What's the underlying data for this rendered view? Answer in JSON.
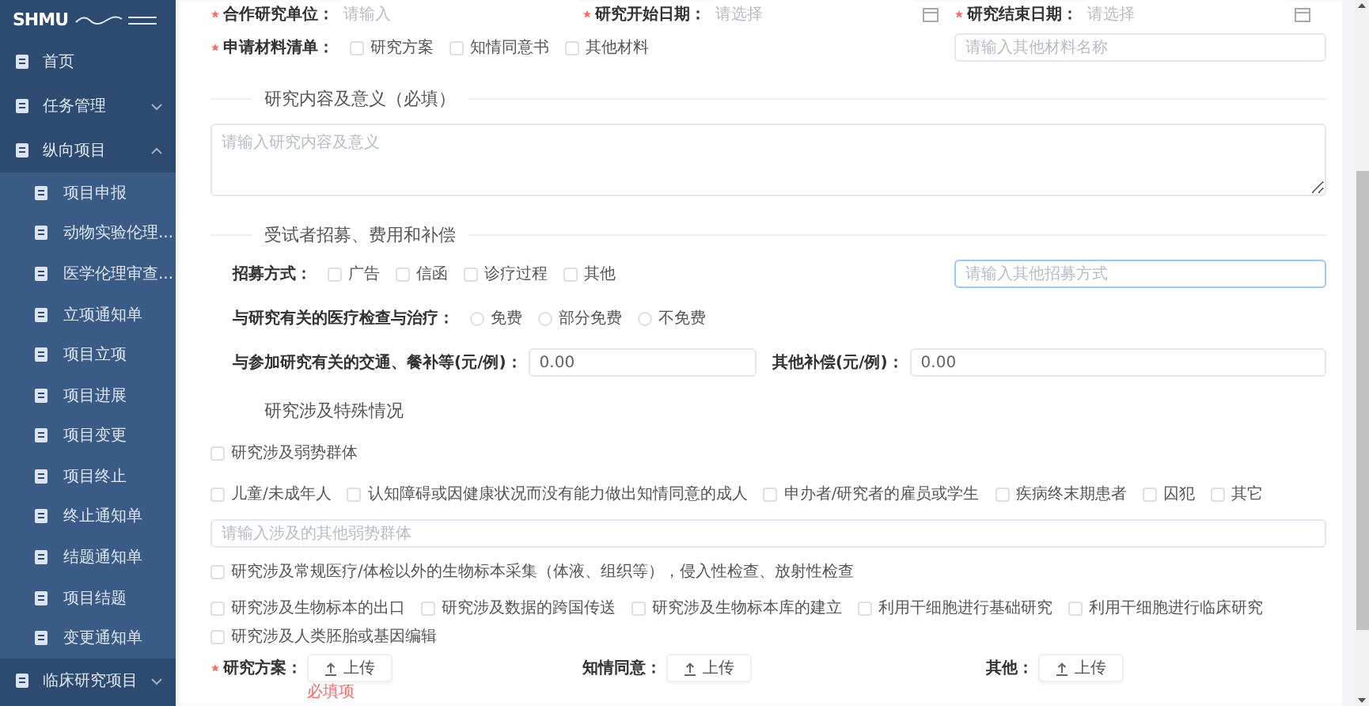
{
  "sidebar": {
    "logo": "SHMU",
    "items": [
      {
        "label": "首页"
      },
      {
        "label": "任务管理",
        "expanded": false
      },
      {
        "label": "纵向项目",
        "expanded": true,
        "children": [
          {
            "label": "项目申报",
            "selected": false
          },
          {
            "label": "动物实验伦理...",
            "selected": false
          },
          {
            "label": "医学伦理审查...",
            "selected": false
          },
          {
            "label": "立项通知单",
            "selected": false
          },
          {
            "label": "项目立项",
            "selected": false
          },
          {
            "label": "项目进展",
            "selected": false
          },
          {
            "label": "项目变更",
            "selected": false
          },
          {
            "label": "项目终止",
            "selected": false
          },
          {
            "label": "终止通知单",
            "selected": false
          },
          {
            "label": "结题通知单",
            "selected": false
          },
          {
            "label": "项目结题",
            "selected": false
          },
          {
            "label": "变更通知单",
            "selected": false
          }
        ]
      },
      {
        "label": "临床研究项目",
        "expanded": false
      }
    ]
  },
  "form": {
    "blocks": [
      {
        "kind": "fields",
        "fields": [
          {
            "kind": "text",
            "label": "合作研究单位：",
            "placeholder": "请输入",
            "required": true
          },
          {
            "kind": "date",
            "label": "研究开始日期：",
            "placeholder": "请选择",
            "required": true
          },
          {
            "kind": "date",
            "label": "研究结束日期：",
            "placeholder": "请选择",
            "required": true
          }
        ]
      },
      {
        "kind": "checks",
        "label": "申请材料清单：",
        "required": true,
        "options": [
          {
            "label": "研究方案",
            "checked": false
          },
          {
            "label": "知情同意书",
            "checked": false
          },
          {
            "label": "其他材料",
            "checked": false
          }
        ],
        "input": {
          "placeholder": "请输入其他材料名称",
          "focused": false
        }
      },
      {
        "kind": "divider",
        "title": "研究内容及意义（必填）"
      },
      {
        "kind": "textarea",
        "placeholder": "请输入研究内容及意义"
      },
      {
        "kind": "divider",
        "title": "受试者招募、费用和补偿"
      },
      {
        "kind": "checks",
        "label": "招募方式：",
        "required": false,
        "options": [
          {
            "label": "广告",
            "checked": false
          },
          {
            "label": "信函",
            "checked": false
          },
          {
            "label": "诊疗过程",
            "checked": false
          },
          {
            "label": "其他",
            "checked": false
          }
        ],
        "input": {
          "placeholder": "请输入其他招募方式",
          "focused": true
        }
      },
      {
        "kind": "radios",
        "label": "与研究有关的医疗检查与治疗：",
        "options": [
          {
            "label": "免费",
            "selected": false
          },
          {
            "label": "部分免费",
            "selected": false
          },
          {
            "label": "不免费",
            "selected": false
          }
        ]
      },
      {
        "kind": "money",
        "fields": [
          {
            "label": "与参加研究有关的交通、餐补等(元/例)：",
            "value": "0.00"
          },
          {
            "label": "其他补偿(元/例)：",
            "value": "0.00"
          }
        ]
      },
      {
        "kind": "heading",
        "title": "研究涉及特殊情况"
      },
      {
        "kind": "checks",
        "options": [
          {
            "label": "研究涉及弱势群体",
            "checked": false
          }
        ]
      },
      {
        "kind": "checks",
        "options": [
          {
            "label": "儿童/未成年人",
            "checked": false
          },
          {
            "label": "认知障碍或因健康状况而没有能力做出知情同意的成人",
            "checked": false
          },
          {
            "label": "申办者/研究者的雇员或学生",
            "checked": false
          },
          {
            "label": "疾病终末期患者",
            "checked": false
          },
          {
            "label": "囚犯",
            "checked": false
          },
          {
            "label": "其它",
            "checked": false
          }
        ]
      },
      {
        "kind": "input",
        "placeholder": "请输入涉及的其他弱势群体",
        "focused": false
      },
      {
        "kind": "checks",
        "options": [
          {
            "label": "研究涉及常规医疗/体检以外的生物标本采集（体液、组织等），侵入性检查、放射性检查",
            "checked": false
          }
        ]
      },
      {
        "kind": "checks",
        "options": [
          {
            "label": "研究涉及生物标本的出口",
            "checked": false
          },
          {
            "label": "研究涉及数据的跨国传送",
            "checked": false
          },
          {
            "label": "研究涉及生物标本库的建立",
            "checked": false
          },
          {
            "label": "利用干细胞进行基础研究",
            "checked": false
          },
          {
            "label": "利用干细胞进行临床研究",
            "checked": false
          },
          {
            "label": "研究涉及人类胚胎或基因编辑",
            "checked": false
          }
        ]
      },
      {
        "kind": "uploads",
        "items": [
          {
            "label": "研究方案：",
            "required": true,
            "button": "上传",
            "error": "必填项"
          },
          {
            "label": "知情同意：",
            "required": false,
            "button": "上传"
          },
          {
            "label": "其他：",
            "required": false,
            "button": "上传"
          }
        ]
      }
    ]
  }
}
